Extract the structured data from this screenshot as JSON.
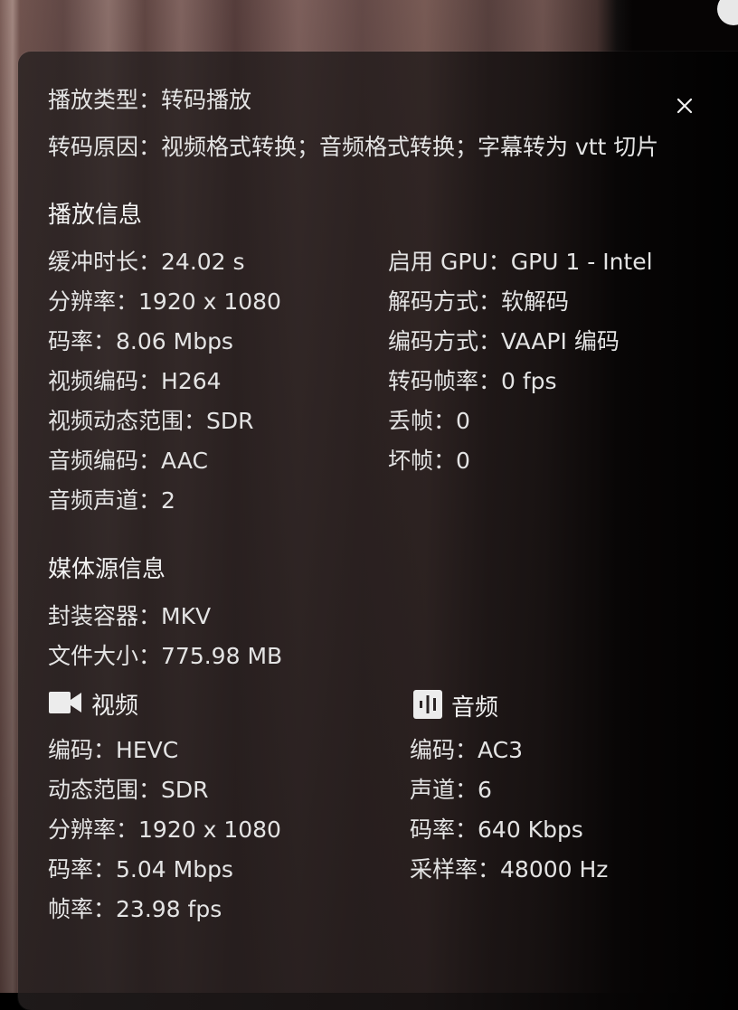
{
  "close_label": "×",
  "playback": {
    "type_label": "播放类型：",
    "type_value": "转码播放",
    "reason_label": "转码原因：",
    "reason_value": "视频格式转换；音频格式转换；字幕转为 vtt 切片"
  },
  "play_info": {
    "title": "播放信息",
    "left": [
      {
        "label": "缓冲时长：",
        "value": "24.02 s"
      },
      {
        "label": "分辨率：",
        "value": "1920 x 1080"
      },
      {
        "label": "码率：",
        "value": "8.06 Mbps"
      },
      {
        "label": "视频编码：",
        "value": "H264"
      },
      {
        "label": "视频动态范围：",
        "value": "SDR"
      },
      {
        "label": "音频编码：",
        "value": "AAC"
      },
      {
        "label": "音频声道：",
        "value": "2"
      }
    ],
    "right": [
      {
        "label": "启用 GPU：",
        "value": "GPU 1 - Intel"
      },
      {
        "label": "解码方式：",
        "value": "软解码"
      },
      {
        "label": "编码方式：",
        "value": "VAAPI 编码"
      },
      {
        "label": "转码帧率：",
        "value": "0 fps"
      },
      {
        "label": "丢帧：",
        "value": "0"
      },
      {
        "label": "坏帧：",
        "value": "0"
      }
    ]
  },
  "source_info": {
    "title": "媒体源信息",
    "container_label": "封装容器：",
    "container_value": "MKV",
    "size_label": "文件大小：",
    "size_value": "775.98 MB",
    "video": {
      "title": "视频",
      "icon": "video-camera-icon",
      "rows": [
        {
          "label": "编码：",
          "value": "HEVC"
        },
        {
          "label": "动态范围：",
          "value": "SDR"
        },
        {
          "label": "分辨率：",
          "value": "1920 x 1080"
        },
        {
          "label": "码率：",
          "value": "5.04 Mbps"
        },
        {
          "label": "帧率：",
          "value": "23.98 fps"
        }
      ]
    },
    "audio": {
      "title": "音频",
      "icon": "audio-wave-icon",
      "rows": [
        {
          "label": "编码：",
          "value": "AC3"
        },
        {
          "label": "声道：",
          "value": "6"
        },
        {
          "label": "码率：",
          "value": "640 Kbps"
        },
        {
          "label": "采样率：",
          "value": "48000 Hz"
        }
      ]
    }
  },
  "colors": {
    "text": "#e4e4e4",
    "panel": "#261f1f"
  }
}
